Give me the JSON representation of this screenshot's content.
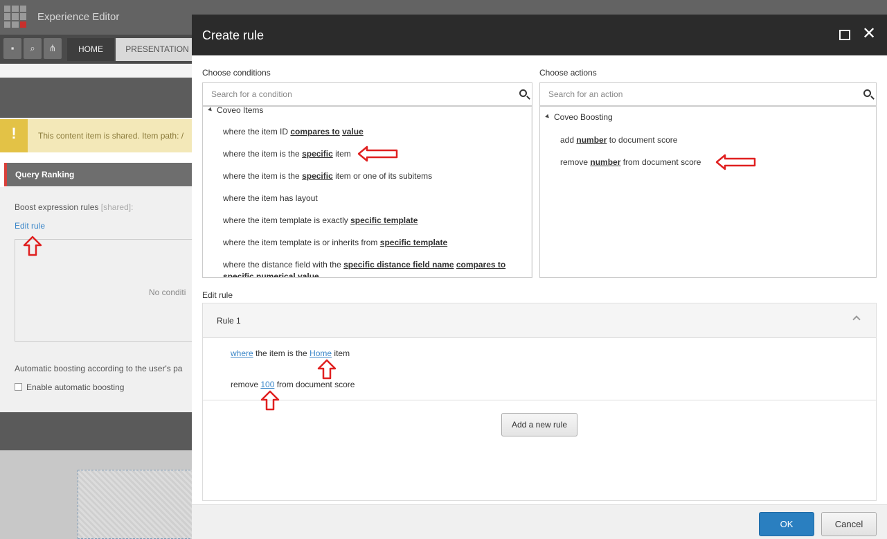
{
  "app": {
    "title": "Experience Editor"
  },
  "ribbon": {
    "tabs": [
      "HOME",
      "PRESENTATION"
    ]
  },
  "background": {
    "notice": "This content item is shared. Item path: /",
    "panel_title": "Query Ranking",
    "boost_label": "Boost expression rules",
    "boost_shared": "[shared]:",
    "edit_rule_link": "Edit rule",
    "no_conditions": "No conditi",
    "auto_boost_label": "Automatic boosting according to the user's pa",
    "enable_auto_label": "Enable automatic boosting"
  },
  "dialog": {
    "title": "Create rule",
    "conditions": {
      "label": "Choose conditions",
      "search_placeholder": "Search for a condition",
      "group": "Coveo Items",
      "items": [
        [
          "where the item ID ",
          "compares to",
          " ",
          "value",
          ""
        ],
        [
          "where the item is the ",
          "specific",
          " item",
          "",
          ""
        ],
        [
          "where the item is the ",
          "specific",
          " item or one of its subitems",
          "",
          ""
        ],
        [
          "where the item has layout",
          "",
          "",
          "",
          ""
        ],
        [
          "where the item template is exactly ",
          "specific template",
          "",
          "",
          ""
        ],
        [
          "where the item template is or inherits from ",
          "specific template",
          "",
          "",
          ""
        ],
        [
          "where the distance field with the ",
          "specific distance field name",
          " ",
          "compares to",
          ""
        ],
        [
          "",
          "specific numerical value",
          "",
          "",
          ""
        ]
      ]
    },
    "actions": {
      "label": "Choose actions",
      "search_placeholder": "Search for an action",
      "group": "Coveo Boosting",
      "items": [
        [
          "add ",
          "number",
          " to document score"
        ],
        [
          "remove ",
          "number",
          " from document score"
        ]
      ]
    },
    "edit_rule": {
      "label": "Edit rule",
      "rule_name": "Rule 1",
      "line1": {
        "where": "where",
        "mid": " the item is the ",
        "value": "Home",
        "end": " item"
      },
      "line2": {
        "start": "remove ",
        "value": "100",
        "end": " from document score"
      },
      "add_button": "Add a new rule"
    },
    "footer": {
      "ok": "OK",
      "cancel": "Cancel"
    }
  },
  "colors": {
    "accent": "#2a7fc0",
    "annotation": "#e02020",
    "header": "#2b2b2b"
  }
}
